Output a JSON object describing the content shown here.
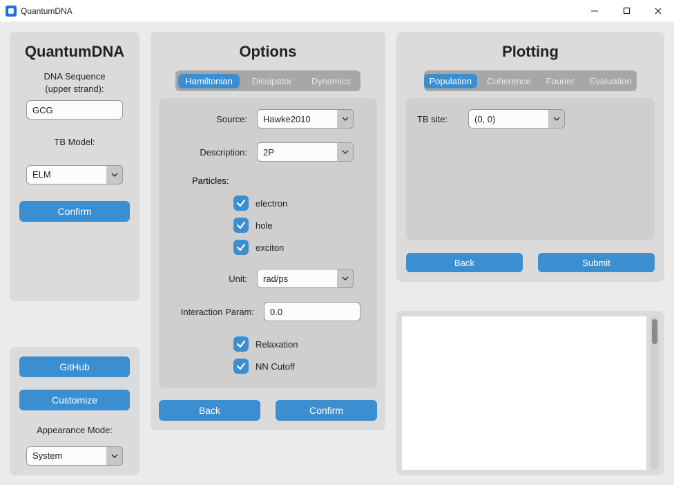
{
  "window": {
    "title": "QuantumDNA"
  },
  "left": {
    "heading": "QuantumDNA",
    "seq_label_line1": "DNA Sequence",
    "seq_label_line2": "(upper strand):",
    "seq_value": "GCG",
    "tb_model_label": "TB Model:",
    "tb_model_value": "ELM",
    "confirm_label": "Confirm",
    "github_label": "GitHub",
    "customize_label": "Customize",
    "appearance_label": "Appearance Mode:",
    "appearance_value": "System"
  },
  "options": {
    "heading": "Options",
    "tabs": [
      "Hamiltonian",
      "Dissipator",
      "Dynamics"
    ],
    "active_tab": "Hamiltonian",
    "source_label": "Source:",
    "source_value": "Hawke2010",
    "description_label": "Description:",
    "description_value": "2P",
    "particles_label": "Particles:",
    "particles": [
      {
        "label": "electron",
        "checked": true
      },
      {
        "label": "hole",
        "checked": true
      },
      {
        "label": "exciton",
        "checked": true
      }
    ],
    "unit_label": "Unit:",
    "unit_value": "rad/ps",
    "interaction_label": "Interaction Param:",
    "interaction_value": "0.0",
    "relaxation_label": "Relaxation",
    "relaxation_checked": true,
    "nn_cutoff_label": "NN Cutoff",
    "nn_cutoff_checked": true,
    "back_label": "Back",
    "confirm_label": "Confirm"
  },
  "plotting": {
    "heading": "Plotting",
    "tabs": [
      "Population",
      "Coherence",
      "Fourier",
      "Evaluation"
    ],
    "active_tab": "Population",
    "tb_site_label": "TB site:",
    "tb_site_value": "(0, 0)",
    "back_label": "Back",
    "submit_label": "Submit"
  }
}
